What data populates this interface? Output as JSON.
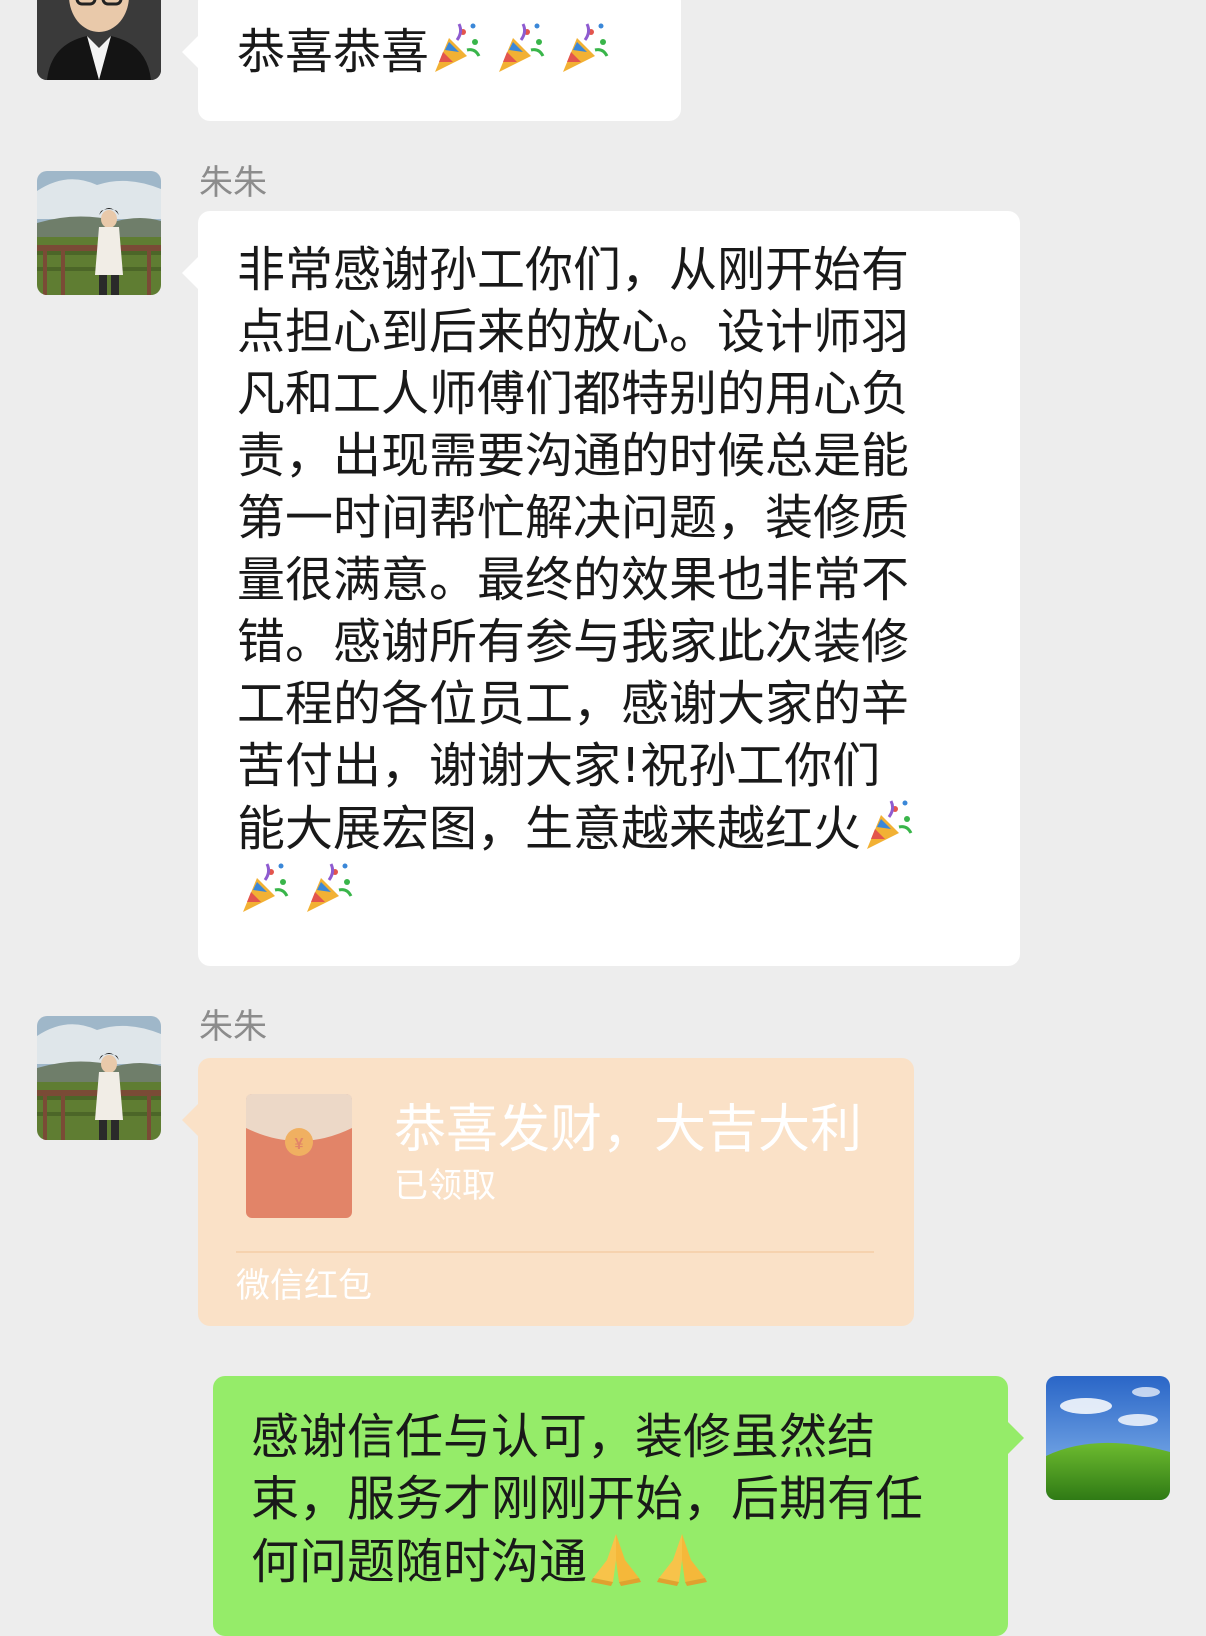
{
  "colors": {
    "background": "#ededed",
    "bubble_incoming": "#ffffff",
    "bubble_outgoing": "#95ec69",
    "red_packet_opened": "#fae1c7",
    "sender_name": "#8c8c8c"
  },
  "messages": [
    {
      "direction": "incoming",
      "sender": "",
      "avatar": "man-in-suit-avatar",
      "text": "恭喜恭喜",
      "emoji": [
        "party-popper-icon",
        "party-popper-icon",
        "party-popper-icon"
      ]
    },
    {
      "direction": "incoming",
      "sender": "朱朱",
      "avatar": "woman-in-field-avatar",
      "text": "非常感谢孙工你们，从刚开始有\n点担心到后来的放心。设计师羽\n凡和工人师傅们都特别的用心负\n责，出现需要沟通的时候总是能\n第一时间帮忙解决问题，装修质\n量很满意。最终的效果也非常不\n错。感谢所有参与我家此次装修\n工程的各位员工，感谢大家的辛\n苦付出，谢谢大家!祝孙工你们\n能大展宏图，生意越来越红火",
      "emoji": [
        "party-popper-icon",
        "party-popper-icon",
        "party-popper-icon"
      ]
    },
    {
      "direction": "incoming",
      "sender": "朱朱",
      "avatar": "woman-in-field-avatar",
      "type": "red_packet",
      "red_packet": {
        "title": "恭喜发财，大吉大利",
        "status": "已领取",
        "footer": "微信红包",
        "envelope_icon": "red-envelope-icon"
      }
    },
    {
      "direction": "outgoing",
      "avatar": "green-hill-landscape-avatar",
      "text": "感谢信任与认可，装修虽然结\n束，服务才刚刚开始，后期有任\n何问题随时沟通",
      "emoji": [
        "folded-hands-icon",
        "folded-hands-icon"
      ]
    }
  ]
}
